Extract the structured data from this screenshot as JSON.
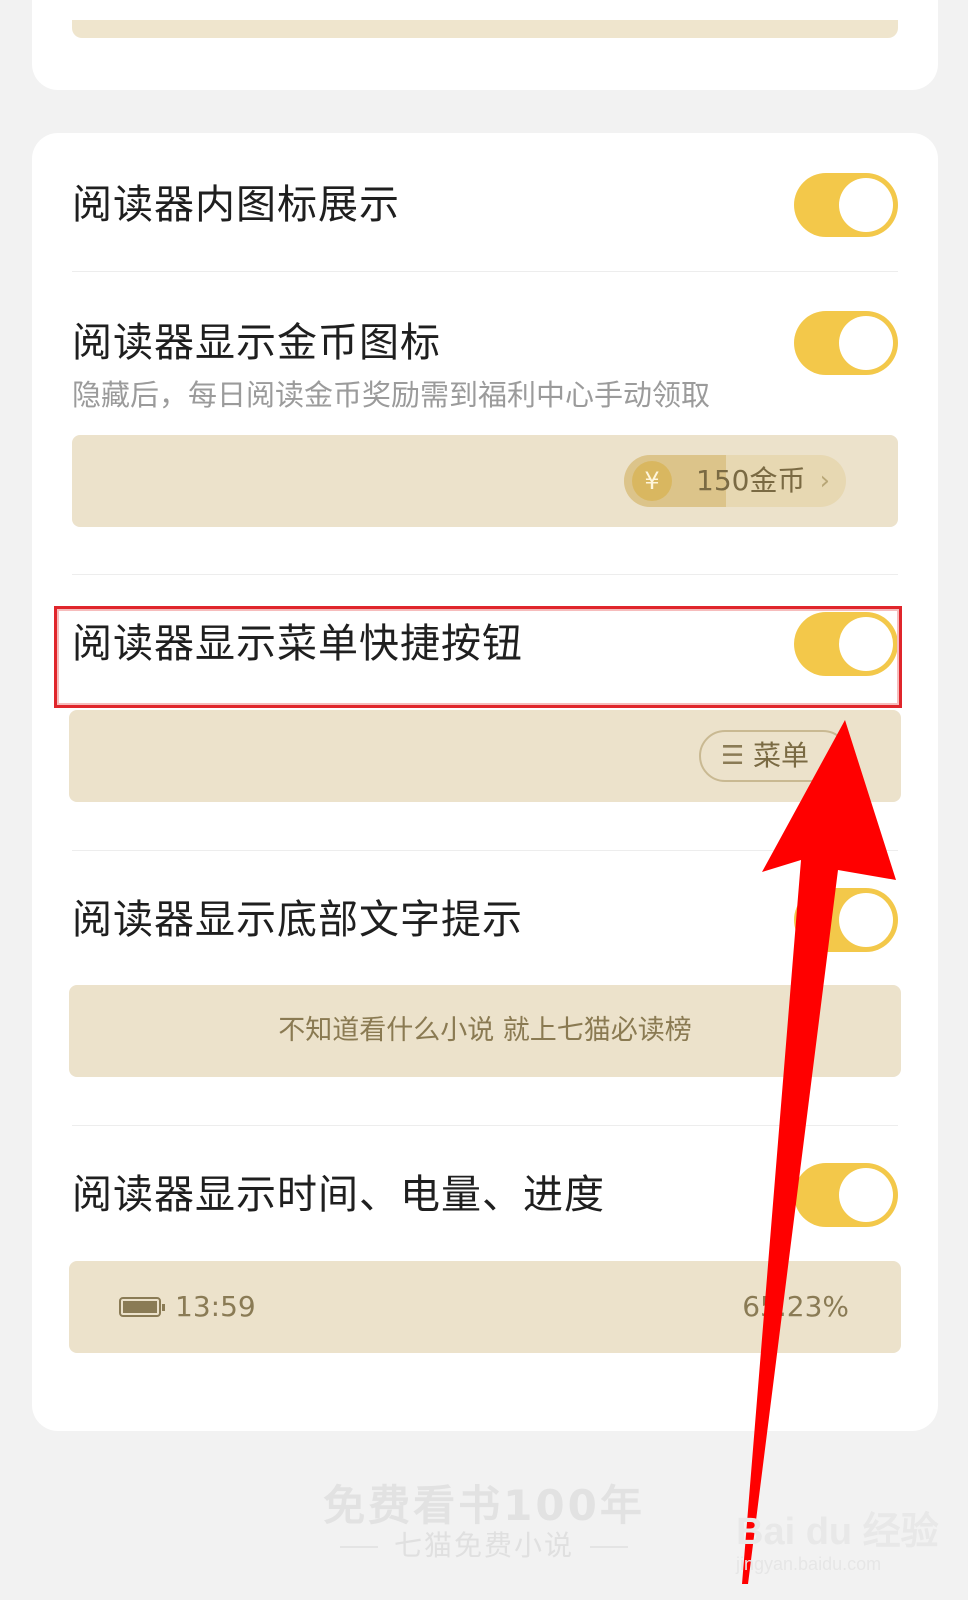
{
  "settings": [
    {
      "title": "阅读器内图标展示",
      "enabled": true
    },
    {
      "title": "阅读器显示金币图标",
      "subtitle": "隐藏后，每日阅读金币奖励需到福利中心手动领取",
      "enabled": true,
      "preview": {
        "coin_symbol": "¥",
        "coin_label": "150金币",
        "chevron": "›"
      }
    },
    {
      "title": "阅读器显示菜单快捷按钮",
      "enabled": true,
      "preview": {
        "menu_icon": "☰",
        "menu_label": "菜单"
      }
    },
    {
      "title": "阅读器显示底部文字提示",
      "enabled": true,
      "preview": {
        "tip": "不知道看什么小说 就上七猫必读榜"
      }
    },
    {
      "title": "阅读器显示时间、电量、进度",
      "enabled": true,
      "preview": {
        "time": "13:59",
        "progress": "65.23%"
      }
    }
  ],
  "annotation": {
    "highlight_color": "#e0252b",
    "arrow_color": "#ff0000"
  },
  "footer": {
    "slogan": "免费看书100年",
    "app_name": "七猫免费小说"
  },
  "watermark": {
    "logo": "Bai du 经验",
    "url": "jingyan.baidu.com"
  },
  "colors": {
    "toggle_on": "#f3c84a",
    "preview_bg": "#ece2cb",
    "page_bg": "#f2f2f2"
  }
}
